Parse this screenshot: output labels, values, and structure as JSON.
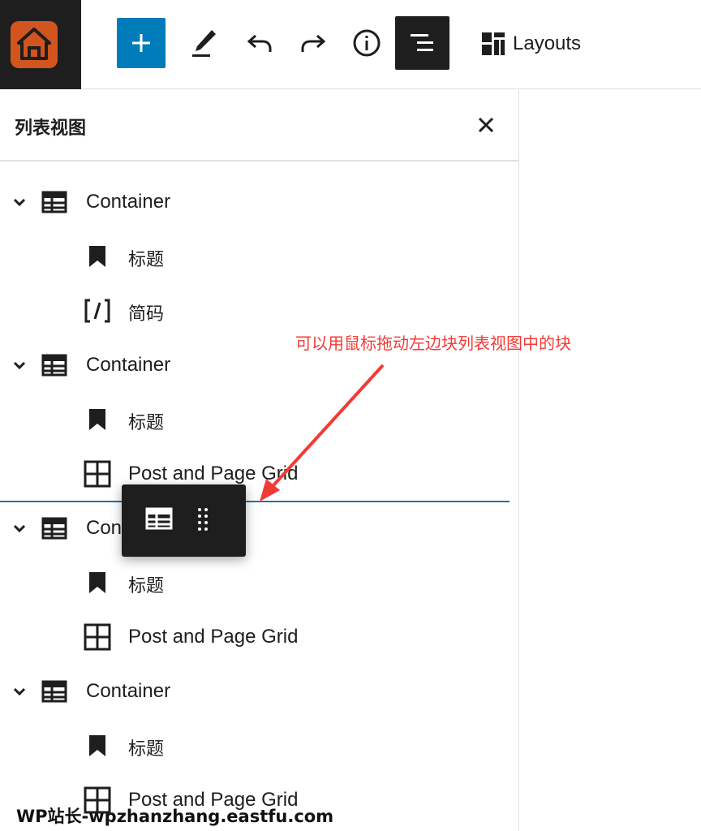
{
  "toolbar": {
    "layouts_label": "Layouts"
  },
  "panel": {
    "title": "列表视图"
  },
  "list": [
    {
      "label": "Container",
      "icon": "table-icon",
      "expanded": true
    },
    {
      "label": "标题",
      "icon": "bookmark-icon"
    },
    {
      "label": "简码",
      "icon": "shortcode-icon"
    },
    {
      "label": "Container",
      "icon": "table-icon",
      "expanded": true
    },
    {
      "label": "标题",
      "icon": "bookmark-icon"
    },
    {
      "label": "Post and Page Grid",
      "icon": "grid-icon"
    },
    {
      "label": "Con",
      "icon": "table-icon",
      "expanded": true
    },
    {
      "label": "标题",
      "icon": "bookmark-icon"
    },
    {
      "label": "Post and Page Grid",
      "icon": "grid-icon"
    },
    {
      "label": "Container",
      "icon": "table-icon",
      "expanded": true
    },
    {
      "label": "标题",
      "icon": "bookmark-icon"
    },
    {
      "label": "Post and Page Grid",
      "icon": "grid-icon"
    }
  ],
  "annotation": {
    "text": "可以用鼠标拖动左边块列表视图中的块",
    "color": "#f23b36"
  },
  "watermark": {
    "text": "WP站长-wpzhanzhang.eastfu.com"
  },
  "colors": {
    "accent": "#007cba",
    "dark": "#1e1e1e",
    "site_icon": "#d2541f",
    "drop_indicator": "#2d6e9f"
  }
}
